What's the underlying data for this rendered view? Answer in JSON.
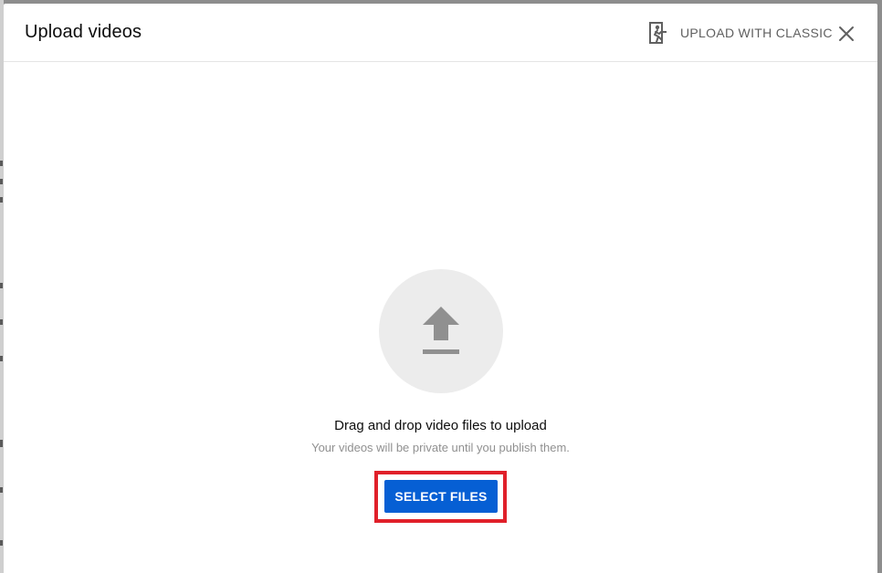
{
  "dialog": {
    "title": "Upload videos",
    "classic_label": "UPLOAD WITH CLASSIC",
    "classic_icon": "exit-to-classic-icon",
    "close_icon": "close-icon"
  },
  "upload_area": {
    "icon": "upload-arrow-icon",
    "drag_text": "Drag and drop video files to upload",
    "private_text": "Your videos will be private until you publish them.",
    "select_files_label": "SELECT FILES"
  },
  "colors": {
    "primary_button": "#065fd4",
    "highlight_box": "#e0202a",
    "icon_gray": "#909090",
    "circle_bg": "#ececec"
  }
}
